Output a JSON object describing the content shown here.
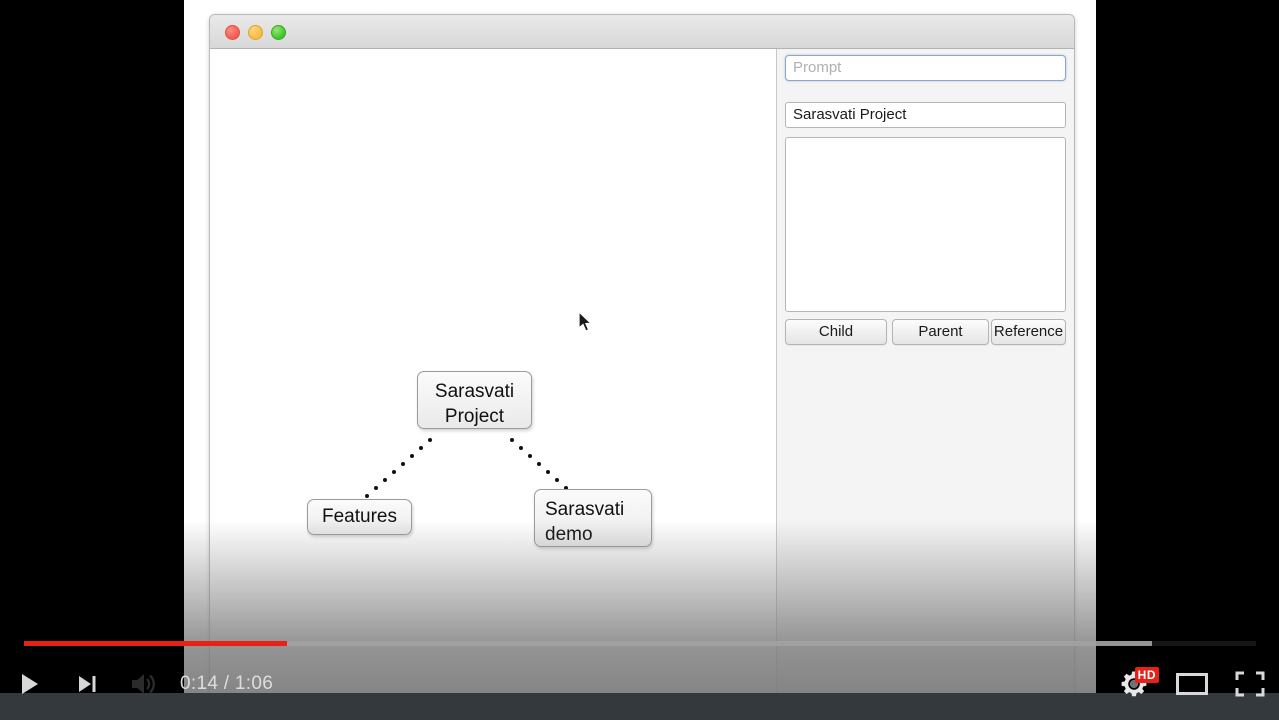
{
  "player": {
    "current_time": "0:14",
    "total_time": "1:06",
    "time_display": "0:14 / 1:06",
    "progress_percent": 21,
    "buffered_percent": 92,
    "quality_badge": "HD",
    "accent_color": "#e62117",
    "controls": {
      "play_label": "Play",
      "next_label": "Next video",
      "volume_label": "Mute",
      "settings_label": "Settings",
      "theater_label": "Theater mode",
      "fullscreen_label": "Full screen"
    },
    "icons": {
      "play": "play-icon",
      "next": "next-video-icon",
      "volume": "volume-icon",
      "settings": "gear-icon",
      "theater": "theater-mode-icon",
      "fullscreen": "fullscreen-icon"
    }
  },
  "app": {
    "window": {
      "traffic_lights": [
        "close",
        "minimize",
        "maximize"
      ]
    },
    "panel": {
      "prompt": {
        "placeholder": "Prompt",
        "value": ""
      },
      "title": {
        "value": "Sarasvati Project"
      },
      "description": {
        "value": ""
      },
      "buttons": [
        {
          "label": "Child"
        },
        {
          "label": "Parent"
        },
        {
          "label": "Reference"
        }
      ]
    },
    "graph": {
      "nodes": [
        {
          "id": "root",
          "label": "Sarasvati\nProject"
        },
        {
          "id": "features",
          "label": "Features"
        },
        {
          "id": "demo",
          "label": "Sarasvati\ndemo"
        }
      ],
      "edges": [
        {
          "from": "root",
          "to": "features",
          "style": "dotted"
        },
        {
          "from": "root",
          "to": "demo",
          "style": "dotted"
        }
      ]
    }
  }
}
